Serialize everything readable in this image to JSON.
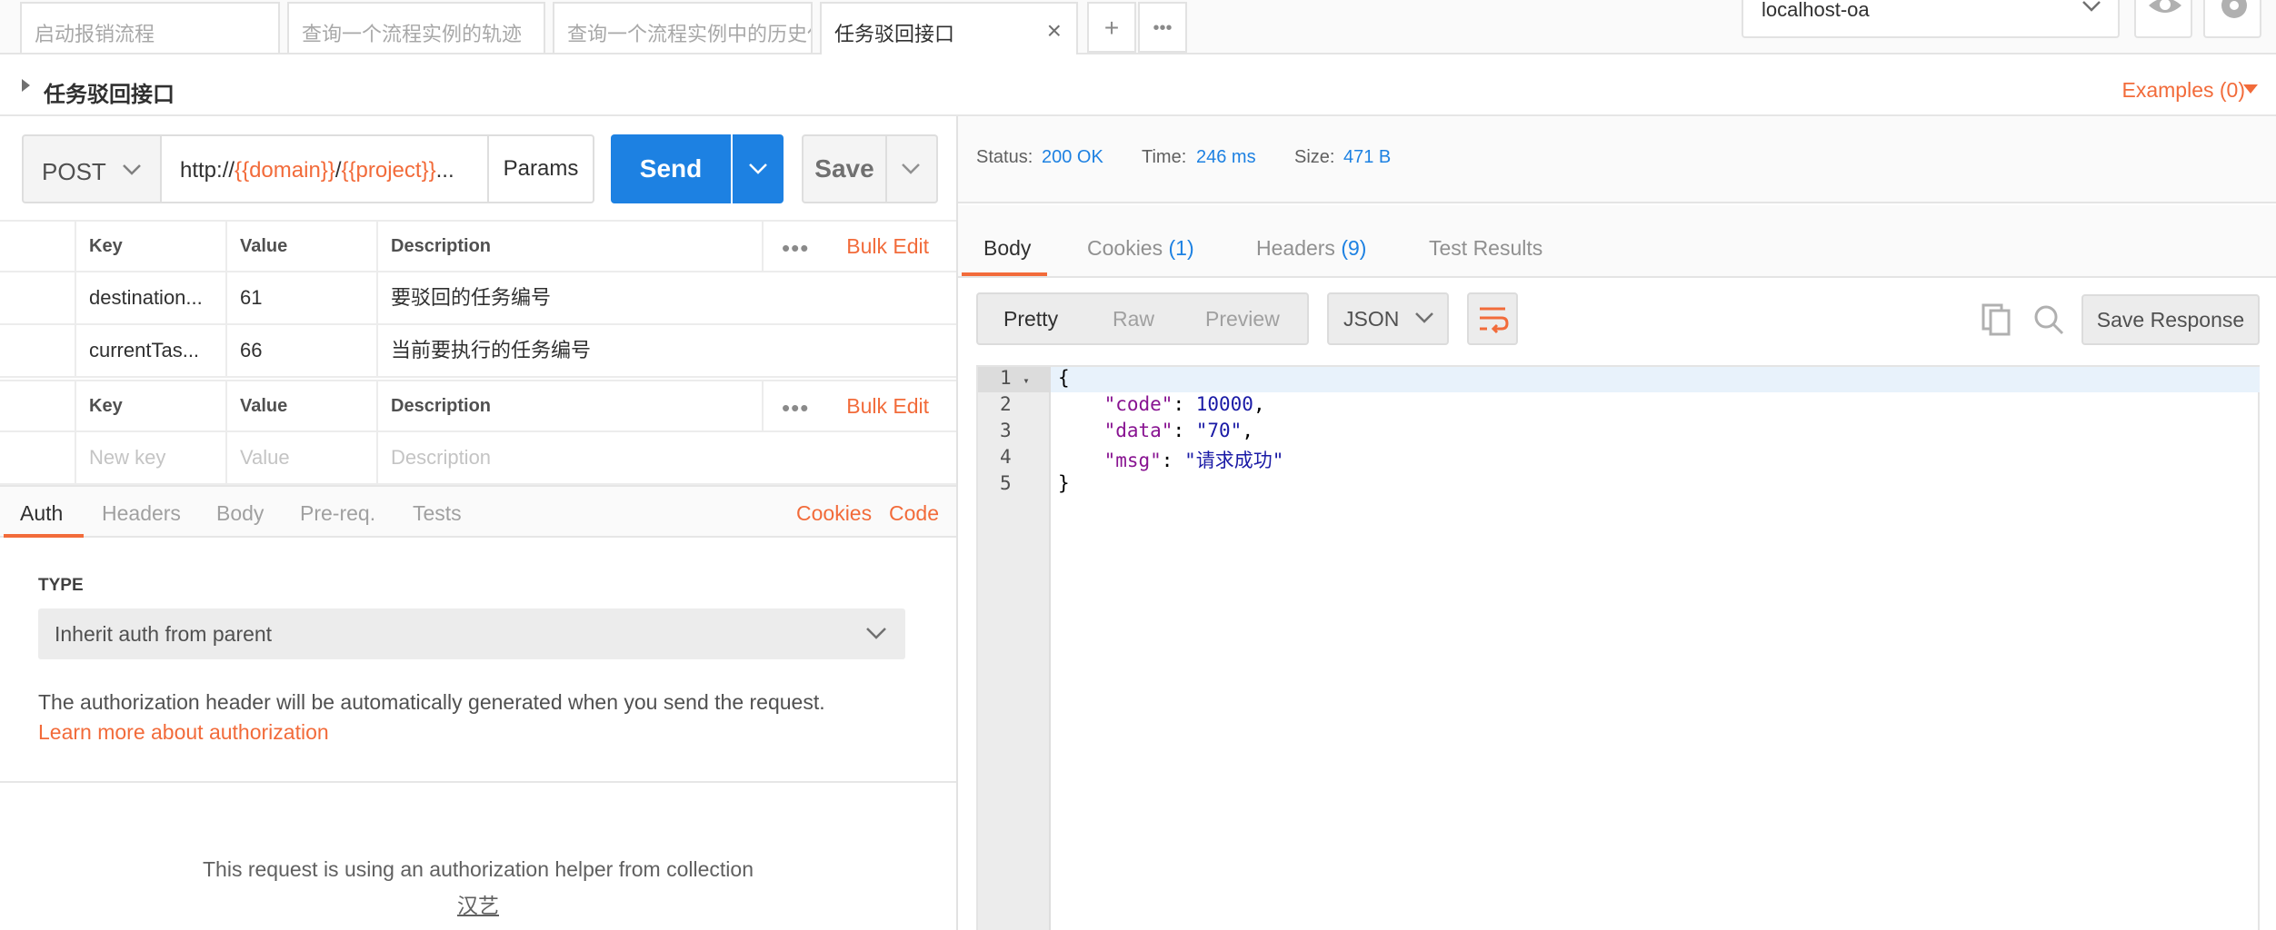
{
  "tabs": [
    {
      "label": "启动报销流程"
    },
    {
      "label": "查询一个流程实例的轨迹"
    },
    {
      "label": "查询一个流程实例中的历史任"
    },
    {
      "label": "任务驳回接口"
    }
  ],
  "tab_add": "+",
  "tab_more": "•••",
  "environment": "localhost-oa",
  "request": {
    "name": "任务驳回接口",
    "examples": "Examples (0)",
    "method": "POST",
    "url_parts": {
      "p1": "http://",
      "v1": "{{domain}}",
      "p2": "/",
      "v2": "{{project}}",
      "p3": "..."
    },
    "params_label": "Params",
    "send_label": "Send",
    "save_label": "Save"
  },
  "params_table": {
    "headers": {
      "key": "Key",
      "value": "Value",
      "description": "Description"
    },
    "more": "•••",
    "bulk_edit": "Bulk Edit",
    "rows": [
      {
        "key": "destination...",
        "value": "61",
        "description": "要驳回的任务编号"
      },
      {
        "key": "currentTas...",
        "value": "66",
        "description": "当前要执行的任务编号"
      }
    ]
  },
  "body_table": {
    "headers": {
      "key": "Key",
      "value": "Value",
      "description": "Description"
    },
    "more": "•••",
    "bulk_edit": "Bulk Edit",
    "placeholders": {
      "key": "New key",
      "value": "Value",
      "description": "Description"
    }
  },
  "req_tabs": [
    "Auth",
    "Headers",
    "Body",
    "Pre-req.",
    "Tests"
  ],
  "req_links": {
    "cookies": "Cookies",
    "code": "Code"
  },
  "auth": {
    "type_label": "TYPE",
    "type_value": "Inherit auth from parent",
    "description": "The authorization header will be automatically generated when you send the request.",
    "learn_more": "Learn more about authorization",
    "helper_text": "This request is using an authorization helper from collection",
    "collection_name": "汉艺"
  },
  "response": {
    "status_label": "Status:",
    "status_value": "200 OK",
    "time_label": "Time:",
    "time_value": "246 ms",
    "size_label": "Size:",
    "size_value": "471 B",
    "tabs": {
      "body": "Body",
      "cookies": "Cookies",
      "cookies_count": "(1)",
      "headers": "Headers",
      "headers_count": "(9)",
      "tests": "Test Results"
    },
    "views": [
      "Pretty",
      "Raw",
      "Preview"
    ],
    "format": "JSON",
    "save_response": "Save Response",
    "code_lines": [
      {
        "n": "1",
        "text": "{"
      },
      {
        "n": "2",
        "key": "\"code\"",
        "val": "10000",
        "tail": ","
      },
      {
        "n": "3",
        "key": "\"data\"",
        "val": "\"70\"",
        "tail": ","
      },
      {
        "n": "4",
        "key": "\"msg\"",
        "val": "\"请求成功\"",
        "tail": ""
      },
      {
        "n": "5",
        "text": "}"
      }
    ]
  },
  "colors": {
    "accent": "#f26b3a",
    "primary": "#1d81e2"
  }
}
